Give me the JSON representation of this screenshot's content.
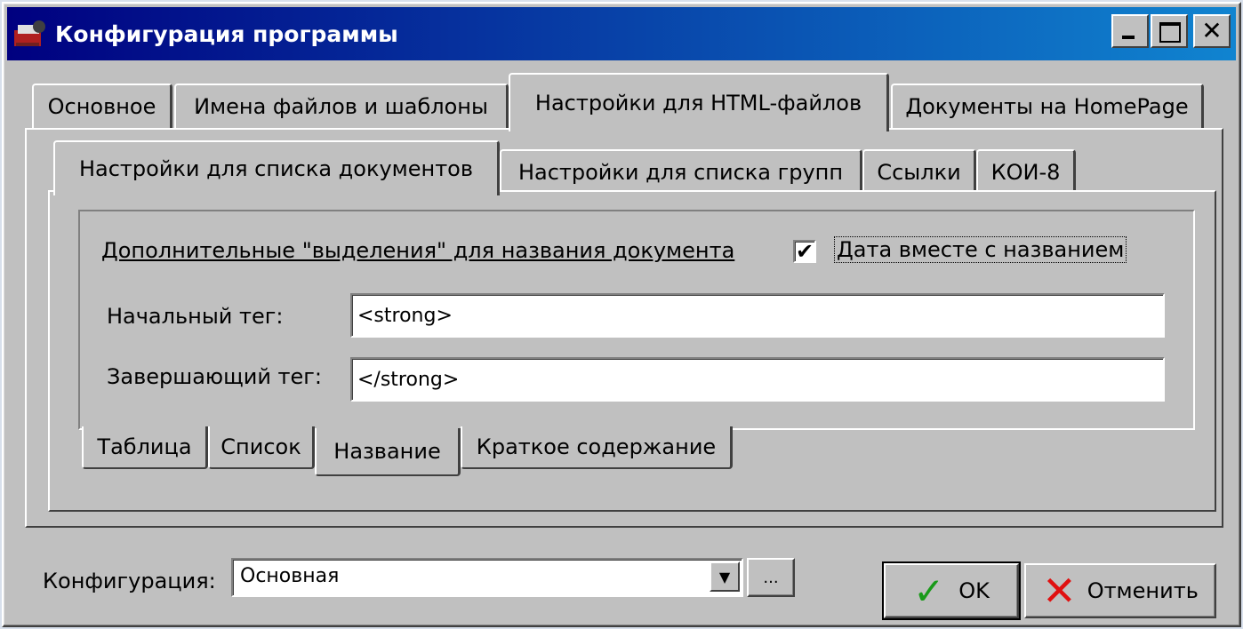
{
  "window": {
    "title": "Конфигурация программы"
  },
  "main_tabs": [
    {
      "label": "Основное"
    },
    {
      "label": "Имена файлов и шаблоны"
    },
    {
      "label": "Настройки для HTML-файлов"
    },
    {
      "label": "Документы на HomePage"
    }
  ],
  "sub_tabs": [
    {
      "label": "Настройки для списка документов"
    },
    {
      "label": "Настройки для списка групп"
    },
    {
      "label": "Ссылки"
    },
    {
      "label": "КОИ-8"
    }
  ],
  "inner": {
    "heading": "Дополнительные \"выделения\" для названия документа",
    "date_checkbox": {
      "label": "Дата вместе с названием",
      "checked": true,
      "mark": "✔"
    },
    "start_tag": {
      "label": "Начальный тег:",
      "value": "<strong>"
    },
    "end_tag": {
      "label": "Завершающий тег:",
      "value": "</strong>"
    }
  },
  "bottom_tabs": [
    {
      "label": "Таблица"
    },
    {
      "label": "Список"
    },
    {
      "label": "Название"
    },
    {
      "label": "Краткое содержание"
    }
  ],
  "footer": {
    "config_label": "Конфигурация:",
    "config_value": "Основная",
    "browse_label": "...",
    "ok_label": "OK",
    "cancel_label": "Отменить"
  }
}
